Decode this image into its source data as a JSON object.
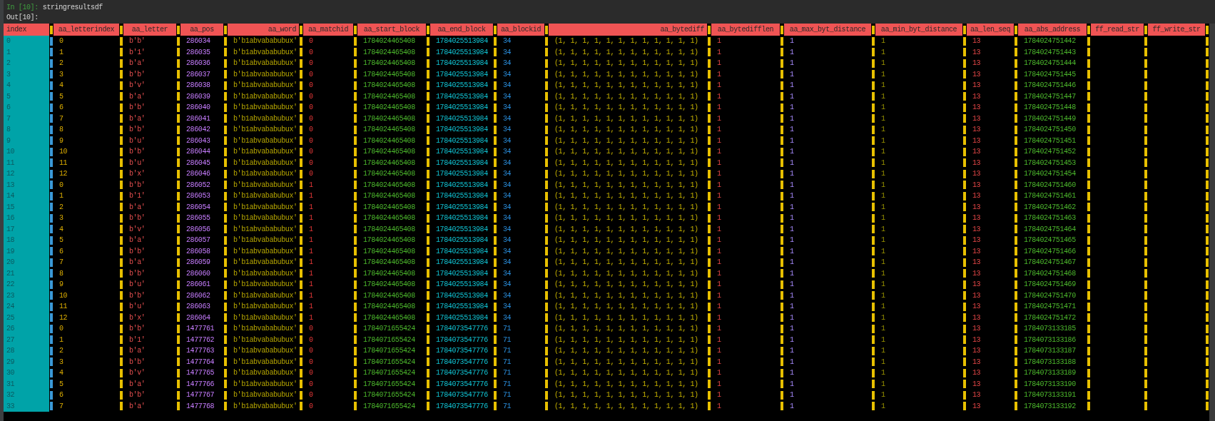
{
  "input": {
    "prompt": "In [10]:",
    "code": "stringresultsdf"
  },
  "output": {
    "prompt": "Out[10]:"
  },
  "table": {
    "columns": [
      "index",
      "aa_letterindex",
      "aa_letter",
      "aa_pos",
      "aa_word",
      "aa_matchid",
      "aa_start_block",
      "aa_end_block",
      "aa_blockid",
      "aa_bytediff",
      "aa_bytedifflen",
      "aa_max_byt_distance",
      "aa_min_byt_distance",
      "aa_len_seq",
      "aa_abs_address",
      "ff_read_str",
      "ff_write_str"
    ],
    "rows": [
      [
        "0",
        "0",
        "b'b'",
        "286034",
        "b'b1abvababubux'",
        "0",
        "1784024465408",
        "1784025513984",
        "34",
        "(1, 1, 1, 1, 1, 1, 1, 1, 1, 1, 1, 1)",
        "1",
        "1",
        "1",
        "13",
        "1784024751442"
      ],
      [
        "1",
        "1",
        "b'1'",
        "286035",
        "b'b1abvababubux'",
        "0",
        "1784024465408",
        "1784025513984",
        "34",
        "(1, 1, 1, 1, 1, 1, 1, 1, 1, 1, 1, 1)",
        "1",
        "1",
        "1",
        "13",
        "1784024751443"
      ],
      [
        "2",
        "2",
        "b'a'",
        "286036",
        "b'b1abvababubux'",
        "0",
        "1784024465408",
        "1784025513984",
        "34",
        "(1, 1, 1, 1, 1, 1, 1, 1, 1, 1, 1, 1)",
        "1",
        "1",
        "1",
        "13",
        "1784024751444"
      ],
      [
        "3",
        "3",
        "b'b'",
        "286037",
        "b'b1abvababubux'",
        "0",
        "1784024465408",
        "1784025513984",
        "34",
        "(1, 1, 1, 1, 1, 1, 1, 1, 1, 1, 1, 1)",
        "1",
        "1",
        "1",
        "13",
        "1784024751445"
      ],
      [
        "4",
        "4",
        "b'v'",
        "286038",
        "b'b1abvababubux'",
        "0",
        "1784024465408",
        "1784025513984",
        "34",
        "(1, 1, 1, 1, 1, 1, 1, 1, 1, 1, 1, 1)",
        "1",
        "1",
        "1",
        "13",
        "1784024751446"
      ],
      [
        "5",
        "5",
        "b'a'",
        "286039",
        "b'b1abvababubux'",
        "0",
        "1784024465408",
        "1784025513984",
        "34",
        "(1, 1, 1, 1, 1, 1, 1, 1, 1, 1, 1, 1)",
        "1",
        "1",
        "1",
        "13",
        "1784024751447"
      ],
      [
        "6",
        "6",
        "b'b'",
        "286040",
        "b'b1abvababubux'",
        "0",
        "1784024465408",
        "1784025513984",
        "34",
        "(1, 1, 1, 1, 1, 1, 1, 1, 1, 1, 1, 1)",
        "1",
        "1",
        "1",
        "13",
        "1784024751448"
      ],
      [
        "7",
        "7",
        "b'a'",
        "286041",
        "b'b1abvababubux'",
        "0",
        "1784024465408",
        "1784025513984",
        "34",
        "(1, 1, 1, 1, 1, 1, 1, 1, 1, 1, 1, 1)",
        "1",
        "1",
        "1",
        "13",
        "1784024751449"
      ],
      [
        "8",
        "8",
        "b'b'",
        "286042",
        "b'b1abvababubux'",
        "0",
        "1784024465408",
        "1784025513984",
        "34",
        "(1, 1, 1, 1, 1, 1, 1, 1, 1, 1, 1, 1)",
        "1",
        "1",
        "1",
        "13",
        "1784024751450"
      ],
      [
        "9",
        "9",
        "b'u'",
        "286043",
        "b'b1abvababubux'",
        "0",
        "1784024465408",
        "1784025513984",
        "34",
        "(1, 1, 1, 1, 1, 1, 1, 1, 1, 1, 1, 1)",
        "1",
        "1",
        "1",
        "13",
        "1784024751451"
      ],
      [
        "10",
        "10",
        "b'b'",
        "286044",
        "b'b1abvababubux'",
        "0",
        "1784024465408",
        "1784025513984",
        "34",
        "(1, 1, 1, 1, 1, 1, 1, 1, 1, 1, 1, 1)",
        "1",
        "1",
        "1",
        "13",
        "1784024751452"
      ],
      [
        "11",
        "11",
        "b'u'",
        "286045",
        "b'b1abvababubux'",
        "0",
        "1784024465408",
        "1784025513984",
        "34",
        "(1, 1, 1, 1, 1, 1, 1, 1, 1, 1, 1, 1)",
        "1",
        "1",
        "1",
        "13",
        "1784024751453"
      ],
      [
        "12",
        "12",
        "b'x'",
        "286046",
        "b'b1abvababubux'",
        "0",
        "1784024465408",
        "1784025513984",
        "34",
        "(1, 1, 1, 1, 1, 1, 1, 1, 1, 1, 1, 1)",
        "1",
        "1",
        "1",
        "13",
        "1784024751454"
      ],
      [
        "13",
        "0",
        "b'b'",
        "286052",
        "b'b1abvababubux'",
        "1",
        "1784024465408",
        "1784025513984",
        "34",
        "(1, 1, 1, 1, 1, 1, 1, 1, 1, 1, 1, 1)",
        "1",
        "1",
        "1",
        "13",
        "1784024751460"
      ],
      [
        "14",
        "1",
        "b'1'",
        "286053",
        "b'b1abvababubux'",
        "1",
        "1784024465408",
        "1784025513984",
        "34",
        "(1, 1, 1, 1, 1, 1, 1, 1, 1, 1, 1, 1)",
        "1",
        "1",
        "1",
        "13",
        "1784024751461"
      ],
      [
        "15",
        "2",
        "b'a'",
        "286054",
        "b'b1abvababubux'",
        "1",
        "1784024465408",
        "1784025513984",
        "34",
        "(1, 1, 1, 1, 1, 1, 1, 1, 1, 1, 1, 1)",
        "1",
        "1",
        "1",
        "13",
        "1784024751462"
      ],
      [
        "16",
        "3",
        "b'b'",
        "286055",
        "b'b1abvababubux'",
        "1",
        "1784024465408",
        "1784025513984",
        "34",
        "(1, 1, 1, 1, 1, 1, 1, 1, 1, 1, 1, 1)",
        "1",
        "1",
        "1",
        "13",
        "1784024751463"
      ],
      [
        "17",
        "4",
        "b'v'",
        "286056",
        "b'b1abvababubux'",
        "1",
        "1784024465408",
        "1784025513984",
        "34",
        "(1, 1, 1, 1, 1, 1, 1, 1, 1, 1, 1, 1)",
        "1",
        "1",
        "1",
        "13",
        "1784024751464"
      ],
      [
        "18",
        "5",
        "b'a'",
        "286057",
        "b'b1abvababubux'",
        "1",
        "1784024465408",
        "1784025513984",
        "34",
        "(1, 1, 1, 1, 1, 1, 1, 1, 1, 1, 1, 1)",
        "1",
        "1",
        "1",
        "13",
        "1784024751465"
      ],
      [
        "19",
        "6",
        "b'b'",
        "286058",
        "b'b1abvababubux'",
        "1",
        "1784024465408",
        "1784025513984",
        "34",
        "(1, 1, 1, 1, 1, 1, 1, 1, 1, 1, 1, 1)",
        "1",
        "1",
        "1",
        "13",
        "1784024751466"
      ],
      [
        "20",
        "7",
        "b'a'",
        "286059",
        "b'b1abvababubux'",
        "1",
        "1784024465408",
        "1784025513984",
        "34",
        "(1, 1, 1, 1, 1, 1, 1, 1, 1, 1, 1, 1)",
        "1",
        "1",
        "1",
        "13",
        "1784024751467"
      ],
      [
        "21",
        "8",
        "b'b'",
        "286060",
        "b'b1abvababubux'",
        "1",
        "1784024465408",
        "1784025513984",
        "34",
        "(1, 1, 1, 1, 1, 1, 1, 1, 1, 1, 1, 1)",
        "1",
        "1",
        "1",
        "13",
        "1784024751468"
      ],
      [
        "22",
        "9",
        "b'u'",
        "286061",
        "b'b1abvababubux'",
        "1",
        "1784024465408",
        "1784025513984",
        "34",
        "(1, 1, 1, 1, 1, 1, 1, 1, 1, 1, 1, 1)",
        "1",
        "1",
        "1",
        "13",
        "1784024751469"
      ],
      [
        "23",
        "10",
        "b'b'",
        "286062",
        "b'b1abvababubux'",
        "1",
        "1784024465408",
        "1784025513984",
        "34",
        "(1, 1, 1, 1, 1, 1, 1, 1, 1, 1, 1, 1)",
        "1",
        "1",
        "1",
        "13",
        "1784024751470"
      ],
      [
        "24",
        "11",
        "b'u'",
        "286063",
        "b'b1abvababubux'",
        "1",
        "1784024465408",
        "1784025513984",
        "34",
        "(1, 1, 1, 1, 1, 1, 1, 1, 1, 1, 1, 1)",
        "1",
        "1",
        "1",
        "13",
        "1784024751471"
      ],
      [
        "25",
        "12",
        "b'x'",
        "286064",
        "b'b1abvababubux'",
        "1",
        "1784024465408",
        "1784025513984",
        "34",
        "(1, 1, 1, 1, 1, 1, 1, 1, 1, 1, 1, 1)",
        "1",
        "1",
        "1",
        "13",
        "1784024751472"
      ],
      [
        "26",
        "0",
        "b'b'",
        "1477761",
        "b'b1abvababubux'",
        "0",
        "1784071655424",
        "1784073547776",
        "71",
        "(1, 1, 1, 1, 1, 1, 1, 1, 1, 1, 1, 1)",
        "1",
        "1",
        "1",
        "13",
        "1784073133185"
      ],
      [
        "27",
        "1",
        "b'1'",
        "1477762",
        "b'b1abvababubux'",
        "0",
        "1784071655424",
        "1784073547776",
        "71",
        "(1, 1, 1, 1, 1, 1, 1, 1, 1, 1, 1, 1)",
        "1",
        "1",
        "1",
        "13",
        "1784073133186"
      ],
      [
        "28",
        "2",
        "b'a'",
        "1477763",
        "b'b1abvababubux'",
        "0",
        "1784071655424",
        "1784073547776",
        "71",
        "(1, 1, 1, 1, 1, 1, 1, 1, 1, 1, 1, 1)",
        "1",
        "1",
        "1",
        "13",
        "1784073133187"
      ],
      [
        "29",
        "3",
        "b'b'",
        "1477764",
        "b'b1abvababubux'",
        "0",
        "1784071655424",
        "1784073547776",
        "71",
        "(1, 1, 1, 1, 1, 1, 1, 1, 1, 1, 1, 1)",
        "1",
        "1",
        "1",
        "13",
        "1784073133188"
      ],
      [
        "30",
        "4",
        "b'v'",
        "1477765",
        "b'b1abvababubux'",
        "0",
        "1784071655424",
        "1784073547776",
        "71",
        "(1, 1, 1, 1, 1, 1, 1, 1, 1, 1, 1, 1)",
        "1",
        "1",
        "1",
        "13",
        "1784073133189"
      ],
      [
        "31",
        "5",
        "b'a'",
        "1477766",
        "b'b1abvababubux'",
        "0",
        "1784071655424",
        "1784073547776",
        "71",
        "(1, 1, 1, 1, 1, 1, 1, 1, 1, 1, 1, 1)",
        "1",
        "1",
        "1",
        "13",
        "1784073133190"
      ],
      [
        "32",
        "6",
        "b'b'",
        "1477767",
        "b'b1abvababubux'",
        "0",
        "1784071655424",
        "1784073547776",
        "71",
        "(1, 1, 1, 1, 1, 1, 1, 1, 1, 1, 1, 1)",
        "1",
        "1",
        "1",
        "13",
        "1784073133191"
      ],
      [
        "33",
        "7",
        "b'a'",
        "1477768",
        "b'b1abvababubux'",
        "0",
        "1784071655424",
        "1784073547776",
        "71",
        "(1, 1, 1, 1, 1, 1, 1, 1, 1, 1, 1, 1)",
        "1",
        "1",
        "1",
        "13",
        "1784073133192"
      ]
    ]
  }
}
